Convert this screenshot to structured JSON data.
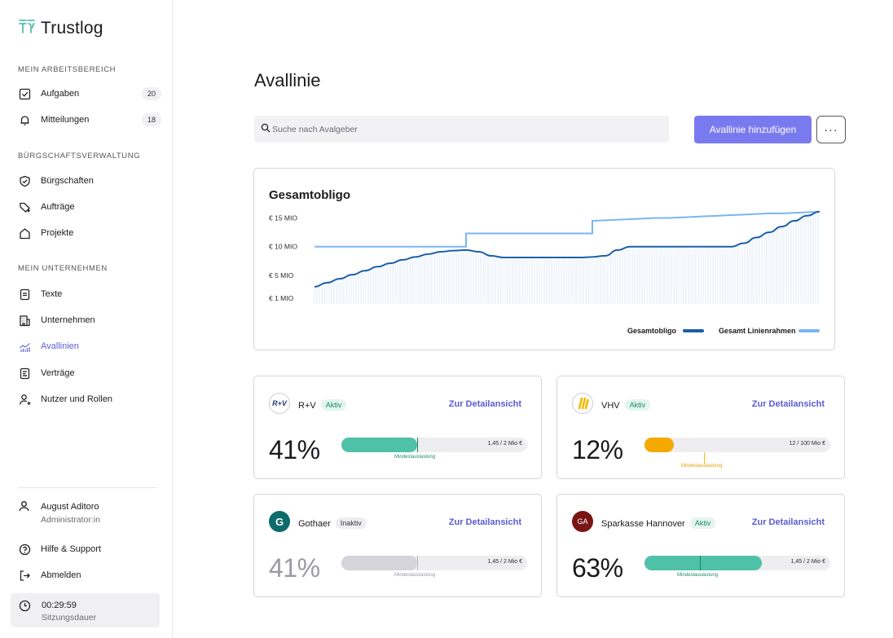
{
  "app": {
    "name": "Trustlog"
  },
  "sidebar": {
    "sections": [
      {
        "title": "MEIN ARBEITSBEREICH"
      },
      {
        "title": "BÜRGSCHAFTSVERWALTUNG"
      },
      {
        "title": "MEIN UNTERNEHMEN"
      }
    ],
    "items": [
      {
        "label": "Aufgaben",
        "badge": "20",
        "icon": "checkbox-icon"
      },
      {
        "label": "Mitteilungen",
        "badge": "18",
        "icon": "bell-icon"
      },
      {
        "label": "Bürgschaften",
        "icon": "shield-check-icon"
      },
      {
        "label": "Aufträge",
        "icon": "tag-plus-icon"
      },
      {
        "label": "Projekte",
        "icon": "house-icon"
      },
      {
        "label": "Texte",
        "icon": "document-icon"
      },
      {
        "label": "Unternehmen",
        "icon": "building-icon"
      },
      {
        "label": "Avallinien",
        "icon": "chart-icon",
        "active": true
      },
      {
        "label": "Verträge",
        "icon": "contract-icon"
      },
      {
        "label": "Nutzer und Rollen",
        "icon": "user-plus-icon"
      }
    ],
    "user": {
      "name": "August Aditoro",
      "role": "Administrator:in"
    },
    "help": "Hilfe & Support",
    "logout": "Abmelden",
    "session": {
      "time": "00:29:59",
      "label": "Sitzungsdauer"
    }
  },
  "main": {
    "title": "Avallinie",
    "search_placeholder": "Suche nach Avalgeber",
    "add_button": "Avallinie hinzufügen",
    "more_button": "···"
  },
  "chart": {
    "title": "Gesamtobligo",
    "legend": [
      {
        "label": "Gesamtobligo",
        "color": "#1a5fa8"
      },
      {
        "label": "Gesamt Linienrahmen",
        "color": "#7ab6f2"
      }
    ]
  },
  "chart_data": {
    "type": "line",
    "title": "Gesamtobligo",
    "ytick_labels": [
      "€ 15 MIO",
      "€ 10 MIO",
      "€ 5 MIO",
      "€ 1 MIO"
    ],
    "yticks": [
      15,
      10,
      5,
      1
    ],
    "ylim": [
      0,
      16.5
    ],
    "series": [
      {
        "name": "Gesamt Linienrahmen",
        "color": "#7ab6f2",
        "values": [
          10,
          10,
          10,
          10,
          10,
          10,
          10,
          10,
          10,
          10,
          10,
          10,
          12.3,
          12.3,
          12.3,
          12.3,
          12.3,
          12.3,
          12.3,
          12.3,
          12.3,
          12.3,
          14.5,
          14.6,
          14.7,
          14.8,
          14.9,
          15,
          15,
          15.1,
          15.2,
          15.3,
          15.4,
          15.5,
          15.6,
          15.7,
          15.8,
          15.8,
          15.9,
          16,
          16.1
        ]
      },
      {
        "name": "Gesamtobligo",
        "color": "#1a5fa8",
        "values": [
          3,
          3.7,
          4.4,
          5.1,
          5.8,
          6.5,
          7.1,
          7.7,
          8.2,
          8.7,
          9.1,
          9.3,
          9.4,
          9.1,
          8.4,
          8.1,
          8.1,
          8.1,
          8.1,
          8.1,
          8.1,
          8.1,
          8.2,
          8.4,
          9.4,
          10.0,
          10.0,
          10.0,
          10.0,
          10.0,
          10.0,
          10.0,
          10.0,
          10.0,
          10.6,
          11.6,
          12.5,
          13.5,
          14.5,
          15.4,
          16.1
        ]
      }
    ],
    "legend_position": "bottom-right",
    "grid": false
  },
  "partners": [
    {
      "name": "R+V",
      "status": "Aktiv",
      "active": true,
      "link": "Zur Detailansicht",
      "percent": "41%",
      "utilization": 0.41,
      "bar_label": "1,45 / 2 Mio €",
      "min_label": "Mindestauslastung",
      "min_threshold": 0.41,
      "color": "#4fc1a8",
      "logo_text": "R+V"
    },
    {
      "name": "VHV",
      "status": "Aktiv",
      "active": true,
      "link": "Zur Detailansicht",
      "percent": "12%",
      "utilization": 0.12,
      "bar_label": "12 / 100 Mio €",
      "min_label": "Mindestauslastung",
      "min_threshold": 0.32,
      "color": "#f5a800",
      "logo_text": "VHV"
    },
    {
      "name": "Gothaer",
      "status": "Inaktiv",
      "active": false,
      "link": "Zur Detailansicht",
      "percent": "41%",
      "utilization": 0.41,
      "bar_label": "1,45 / 2 Mio €",
      "min_label": "Mindestauslastung",
      "min_threshold": 0.41,
      "color": "#d4d4da",
      "logo_text": "G"
    },
    {
      "name": "Sparkasse Hannover",
      "status": "Aktiv",
      "active": true,
      "link": "Zur Detailansicht",
      "percent": "63%",
      "utilization": 0.63,
      "bar_label": "1,45 / 2 Mio €",
      "min_label": "Mindestauslastung",
      "min_threshold": 0.3,
      "color": "#4fc1a8",
      "logo_text": "GA"
    }
  ]
}
